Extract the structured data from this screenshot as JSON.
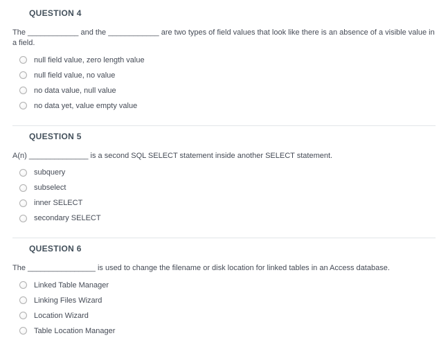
{
  "questions": [
    {
      "title": "QUESTION 4",
      "prompt": "The ____________ and the ____________ are two types of field values that look like there is an absence of a visible value in a field.",
      "options": [
        "null field value, zero length value",
        "null field value, no value",
        "no data value, null value",
        "no data yet, value empty value"
      ]
    },
    {
      "title": "QUESTION 5",
      "prompt": "A(n) ______________ is a second SQL SELECT statement inside another SELECT statement.",
      "options": [
        "subquery",
        "subselect",
        "inner SELECT",
        "secondary SELECT"
      ]
    },
    {
      "title": "QUESTION 6",
      "prompt": "The ________________ is used to change the filename or disk location for linked tables in an Access database.",
      "options": [
        "Linked Table Manager",
        "Linking Files Wizard",
        "Location Wizard",
        "Table Location Manager"
      ]
    }
  ]
}
